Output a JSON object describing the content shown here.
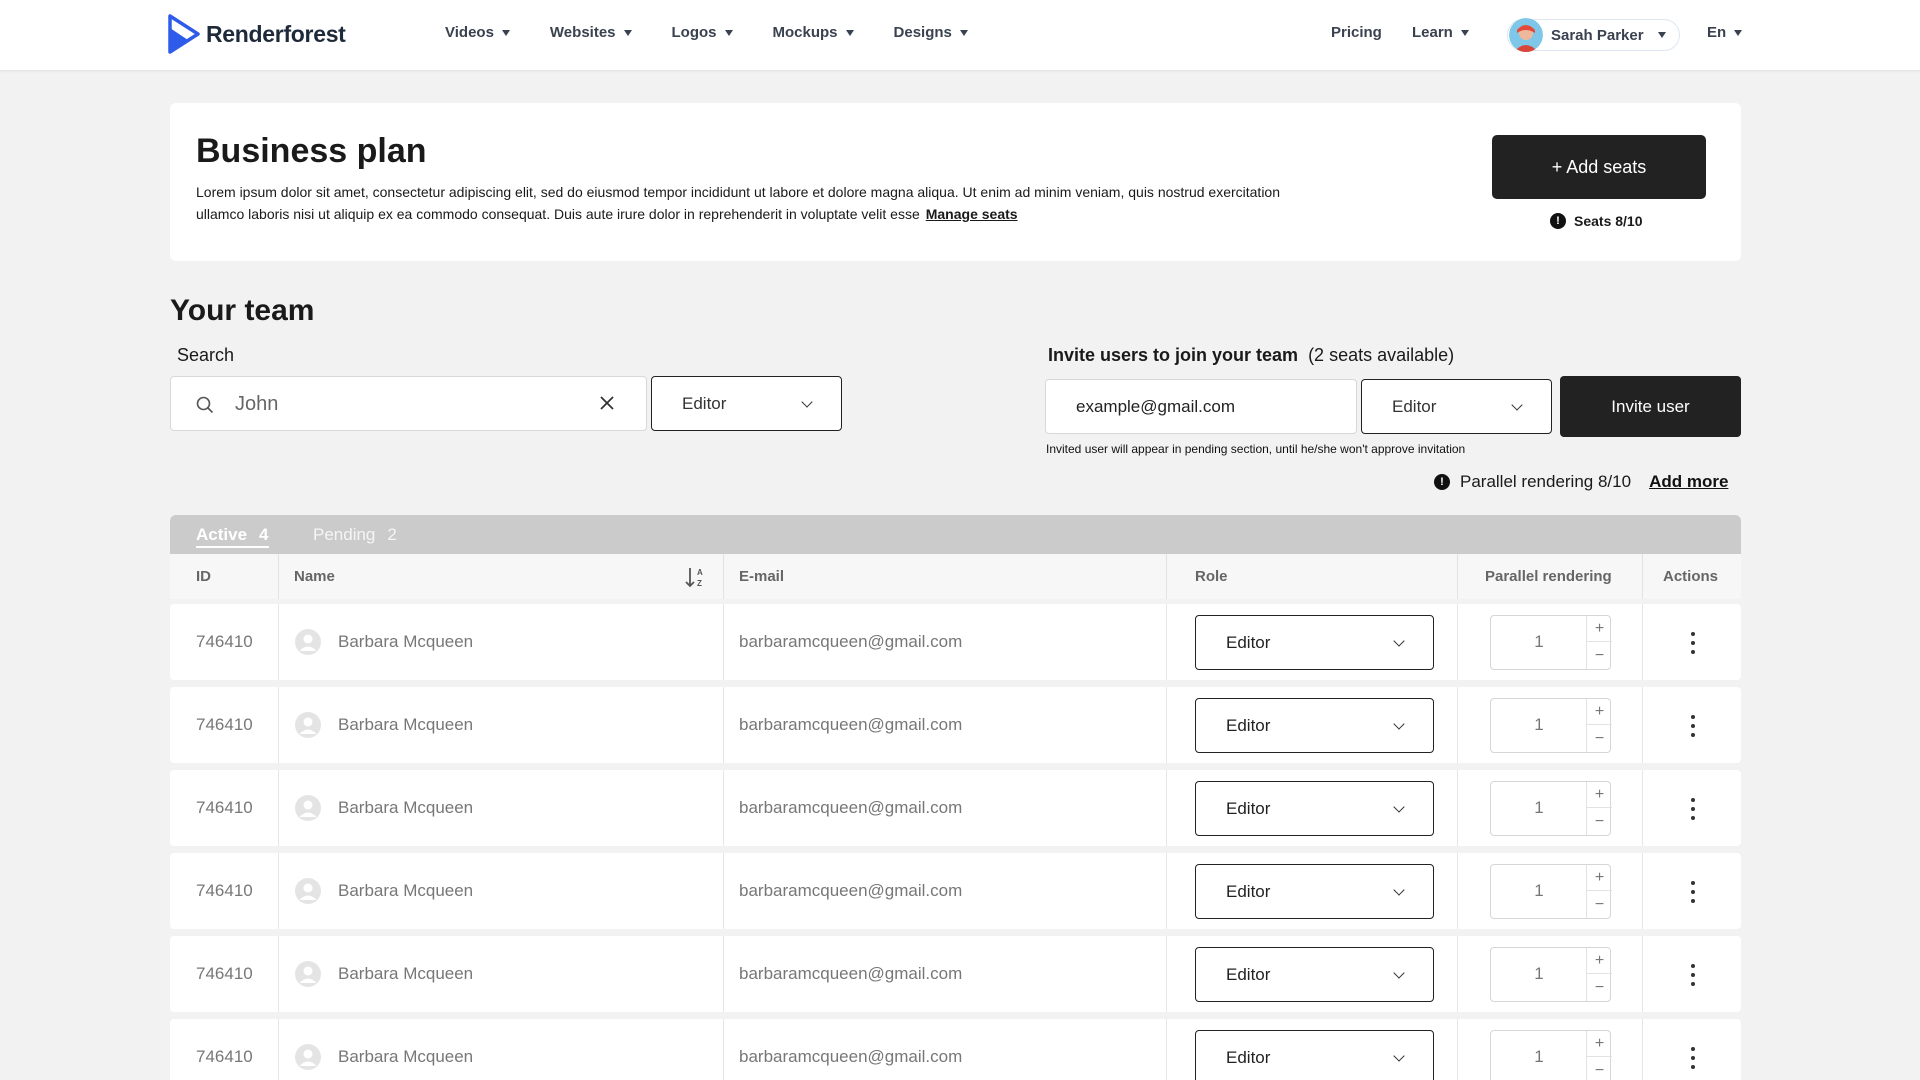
{
  "header": {
    "brand": "Renderforest",
    "nav": [
      {
        "label": "Videos"
      },
      {
        "label": "Websites"
      },
      {
        "label": "Logos"
      },
      {
        "label": "Mockups"
      },
      {
        "label": "Designs"
      }
    ],
    "pricing": "Pricing",
    "learn": "Learn",
    "user_name": "Sarah Parker",
    "language": "En",
    "brand_color": "#2f5bea"
  },
  "plan": {
    "title": "Business plan",
    "description": "Lorem ipsum dolor sit amet, consectetur adipiscing elit, sed do eiusmod tempor incididunt ut labore et dolore magna aliqua. Ut enim ad minim veniam, quis nostrud exercitation ullamco laboris nisi ut aliquip ex ea commodo consequat. Duis aute irure dolor in reprehenderit in voluptate velit esse",
    "manage_link": "Manage seats",
    "add_seats_label": "+ Add seats",
    "seats_text": "Seats 8/10"
  },
  "team": {
    "title": "Your team",
    "search_label": "Search",
    "search_value": "John",
    "role_filter": "Editor"
  },
  "invite": {
    "title": "Invite users to join your team",
    "seats_available": "(2 seats available)",
    "email_value": "example@gmail.com",
    "role": "Editor",
    "button": "Invite user",
    "note": "Invited user will appear in pending section, until he/she won't approve invitation",
    "parallel_text": "Parallel rendering 8/10",
    "add_more": "Add more"
  },
  "table": {
    "tabs": [
      {
        "label": "Active",
        "count": "4"
      },
      {
        "label": "Pending",
        "count": "2"
      }
    ],
    "columns": {
      "id": "ID",
      "name": "Name",
      "email": "E-mail",
      "role": "Role",
      "parallel": "Parallel rendering",
      "actions": "Actions"
    },
    "rows": [
      {
        "id": "746410",
        "name": "Barbara Mcqueen",
        "email": "barbaramcqueen@gmail.com",
        "role": "Editor",
        "parallel": "1"
      },
      {
        "id": "746410",
        "name": "Barbara Mcqueen",
        "email": "barbaramcqueen@gmail.com",
        "role": "Editor",
        "parallel": "1"
      },
      {
        "id": "746410",
        "name": "Barbara Mcqueen",
        "email": "barbaramcqueen@gmail.com",
        "role": "Editor",
        "parallel": "1"
      },
      {
        "id": "746410",
        "name": "Barbara Mcqueen",
        "email": "barbaramcqueen@gmail.com",
        "role": "Editor",
        "parallel": "1"
      },
      {
        "id": "746410",
        "name": "Barbara Mcqueen",
        "email": "barbaramcqueen@gmail.com",
        "role": "Editor",
        "parallel": "1"
      },
      {
        "id": "746410",
        "name": "Barbara Mcqueen",
        "email": "barbaramcqueen@gmail.com",
        "role": "Editor",
        "parallel": "1"
      }
    ]
  }
}
